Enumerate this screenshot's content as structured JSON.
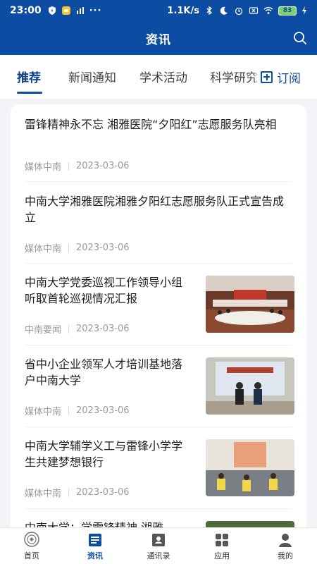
{
  "status_bar": {
    "time": "23:00",
    "network_speed": "1.1K/s",
    "battery": "83"
  },
  "header": {
    "title": "资讯"
  },
  "tabs": [
    {
      "label": "推荐",
      "active": true
    },
    {
      "label": "新闻通知",
      "active": false
    },
    {
      "label": "学术活动",
      "active": false
    },
    {
      "label": "科学研究",
      "active": false
    }
  ],
  "subscribe_label": "订阅",
  "news": [
    {
      "title": "雷锋精神永不忘 湘雅医院“夕阳红”志愿服务队亮相",
      "source": "媒体中南",
      "date": "2023-03-06",
      "has_image": false
    },
    {
      "title": "中南大学湘雅医院湘雅夕阳红志愿服务队正式宣告成立",
      "source": "媒体中南",
      "date": "2023-03-06",
      "has_image": false
    },
    {
      "title": "中南大学党委巡视工作领导小组听取首轮巡视情况汇报",
      "source": "中南要闻",
      "date": "2023-03-06",
      "has_image": true
    },
    {
      "title": "省中小企业领军人才培训基地落户中南大学",
      "source": "媒体中南",
      "date": "2023-03-06",
      "has_image": true
    },
    {
      "title": "中南大学辅学义工与雷锋小学学生共建梦想银行",
      "source": "媒体中南",
      "date": "2023-03-06",
      "has_image": true
    },
    {
      "title": "中南大学：学雷锋精神 湘雅",
      "source": "",
      "date": "",
      "has_image": true
    }
  ],
  "bottom_nav": [
    {
      "label": "首页",
      "icon": "home-logo-icon",
      "active": false
    },
    {
      "label": "资讯",
      "icon": "news-icon",
      "active": true
    },
    {
      "label": "通讯录",
      "icon": "contacts-icon",
      "active": false
    },
    {
      "label": "应用",
      "icon": "apps-grid-icon",
      "active": false
    },
    {
      "label": "我的",
      "icon": "profile-icon",
      "active": false
    }
  ],
  "colors": {
    "brand_blue": "#0d4ca3",
    "active_tab": "#0d3f8f",
    "meta_gray": "#9a9a9a"
  }
}
